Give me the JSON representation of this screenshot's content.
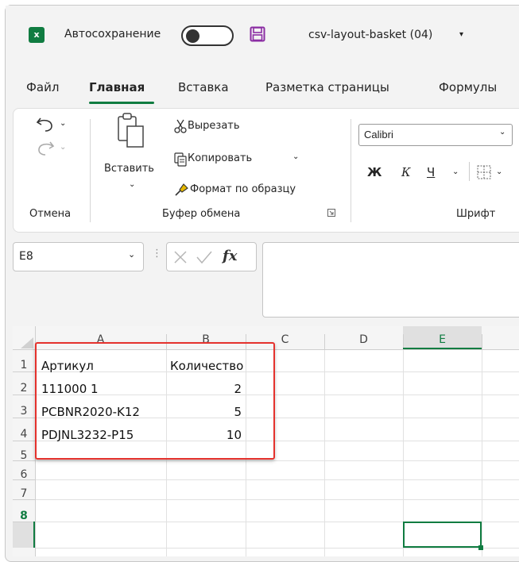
{
  "titlebar": {
    "app_badge": "x",
    "autosave_label": "Автосохранение",
    "file_name": "csv-layout-basket (04)",
    "file_chevron": "▾"
  },
  "tabs": [
    {
      "label": "Файл",
      "active": false
    },
    {
      "label": "Главная",
      "active": true
    },
    {
      "label": "Вставка",
      "active": false
    },
    {
      "label": "Разметка страницы",
      "active": false
    },
    {
      "label": "Формулы",
      "active": false
    }
  ],
  "ribbon": {
    "undo_group_label": "Отмена",
    "paste_label": "Вставить",
    "cut_label": "Вырезать",
    "copy_label": "Копировать",
    "format_painter_label": "Формат по образцу",
    "clipboard_group_label": "Буфер обмена",
    "font_name": "Calibri",
    "bold_label": "Ж",
    "italic_label": "К",
    "underline_label": "Ч",
    "font_group_label": "Шрифт"
  },
  "formula_bar": {
    "name_box": "E8",
    "formula_value": ""
  },
  "sheet": {
    "columns": [
      "A",
      "B",
      "C",
      "D",
      "E"
    ],
    "rows": [
      "1",
      "2",
      "3",
      "4",
      "5",
      "6",
      "7",
      "8"
    ],
    "cells": {
      "a1": "Артикул",
      "b1": "Количество",
      "a2": "111000 1",
      "b2": "2",
      "a3": "PCBNR2020-K12",
      "b3": "5",
      "a4": "PDJNL3232-P15",
      "b4": "10"
    },
    "selected_cell": "E8"
  },
  "colors": {
    "accent": "#107c41",
    "highlight_box": "#e5322d"
  }
}
